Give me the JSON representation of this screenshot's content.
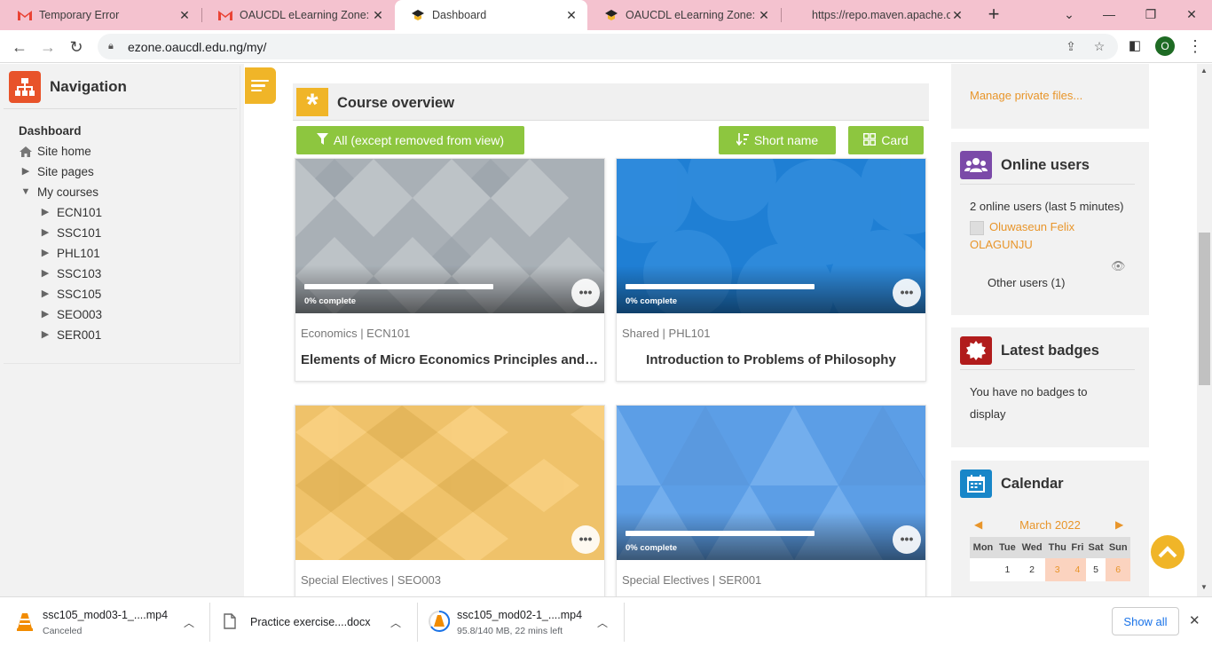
{
  "browser": {
    "tabs": [
      {
        "title": "Temporary Error"
      },
      {
        "title": "OAUCDL eLearning Zone: Pas"
      },
      {
        "title": "Dashboard"
      },
      {
        "title": "OAUCDL eLearning Zone: Lo"
      },
      {
        "title": "https://repo.maven.apache.o"
      }
    ],
    "url": "ezone.oaucdl.edu.ng/my/",
    "profile_initial": "O"
  },
  "navigation": {
    "title": "Navigation",
    "dashboard": "Dashboard",
    "site_home": "Site home",
    "site_pages": "Site pages",
    "my_courses": "My courses",
    "courses": [
      "ECN101",
      "SSC101",
      "PHL101",
      "SSC103",
      "SSC105",
      "SEO003",
      "SER001"
    ]
  },
  "course_overview": {
    "title": "Course overview",
    "filter_label": "All (except removed from view)",
    "sort_label": "Short name",
    "view_label": "Card",
    "cards": [
      {
        "category": "Economics | ECN101",
        "name": "Elements of Micro Economics Principles and ...",
        "progress_label": "0% complete",
        "progress": 0
      },
      {
        "category": "Shared | PHL101",
        "name": "Introduction to Problems of Philosophy",
        "progress_label": "0% complete",
        "progress": 0
      },
      {
        "category": "Special Electives | SEO003",
        "name": "",
        "progress_label": "",
        "progress": null
      },
      {
        "category": "Special Electives | SER001",
        "name": "",
        "progress_label": "0% complete",
        "progress": 0
      }
    ]
  },
  "private_files": {
    "link": "Manage private files..."
  },
  "online_users": {
    "title": "Online users",
    "summary": "2 online users (last 5 minutes)",
    "user_first": "Oluwaseun Felix",
    "user_last": "OLAGUNJU",
    "other": "Other users (1)"
  },
  "badges": {
    "title": "Latest badges",
    "text_1": "You have no badges to",
    "text_2": "display"
  },
  "calendar": {
    "title": "Calendar",
    "month": "March 2022",
    "days": [
      "Mon",
      "Tue",
      "Wed",
      "Thu",
      "Fri",
      "Sat",
      "Sun"
    ],
    "first_row": [
      "",
      "1",
      "2",
      "3",
      "4",
      "5",
      "6"
    ]
  },
  "downloads": [
    {
      "name": "ssc105_mod03-1_....mp4",
      "status": "Canceled"
    },
    {
      "name": "Practice exercise....docx",
      "status": ""
    },
    {
      "name": "ssc105_mod02-1_....mp4",
      "status": "95.8/140 MB, 22 mins left"
    }
  ],
  "show_all": "Show all",
  "colors": {
    "accent": "#f0b528",
    "green": "#8dc63f",
    "link": "#e8952a",
    "nav_icon": "#e8532a"
  }
}
